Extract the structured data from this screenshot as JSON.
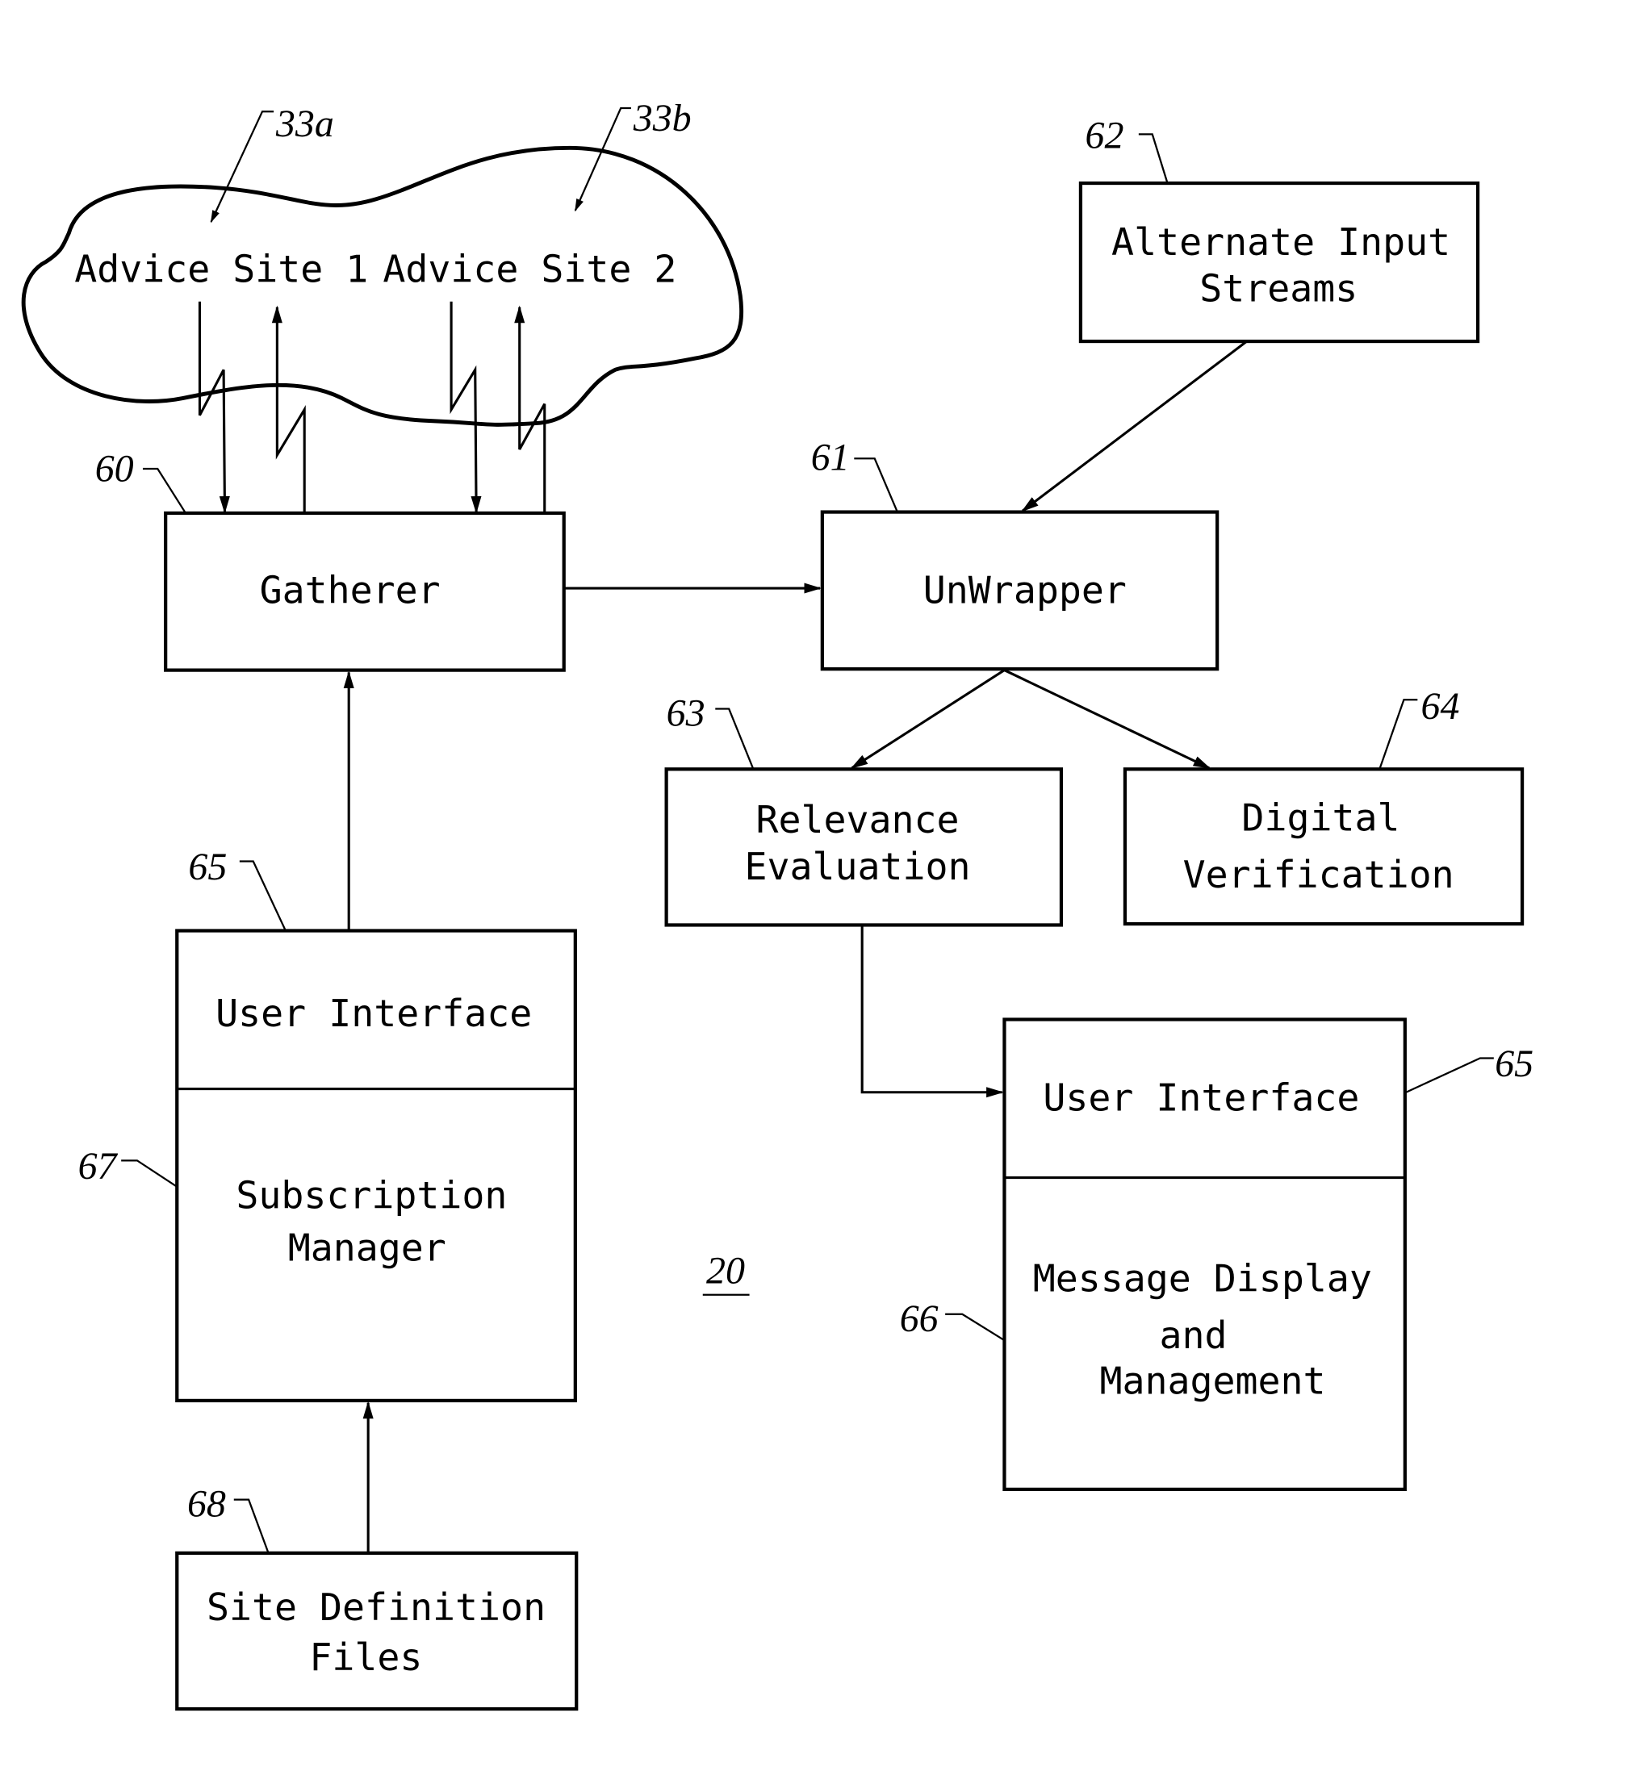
{
  "figure": {
    "number": "20",
    "nodes": {
      "cloud": {
        "ref": [
          "33a",
          "33b"
        ],
        "sites": [
          "Advice Site 1",
          "Advice Site 2"
        ]
      },
      "gatherer": {
        "ref": "60",
        "lines": [
          "Gatherer"
        ]
      },
      "unwrapper": {
        "ref": "61",
        "lines": [
          "UnWrapper"
        ]
      },
      "alternate_input": {
        "ref": "62",
        "lines": [
          "Alternate Input",
          "Streams"
        ]
      },
      "relevance": {
        "ref": "63",
        "lines": [
          "Relevance",
          "Evaluation"
        ]
      },
      "digital_verification": {
        "ref": "64",
        "lines": [
          "Digital",
          "Verification"
        ]
      },
      "left_ui": {
        "ref": "65",
        "top_lines": [
          "User Interface"
        ],
        "bottom_ref": "67",
        "bottom_lines": [
          "Subscription",
          "Manager"
        ]
      },
      "right_ui": {
        "ref": "65",
        "top_lines": [
          "User Interface"
        ],
        "bottom_ref": "66",
        "bottom_lines": [
          "Message Display",
          "and",
          "Management"
        ]
      },
      "site_definition": {
        "ref": "68",
        "lines": [
          "Site Definition",
          "Files"
        ]
      }
    },
    "edges": [
      {
        "from": "advice-site-1",
        "to": "gatherer",
        "type": "wireless"
      },
      {
        "from": "gatherer",
        "to": "advice-site-1",
        "type": "wireless"
      },
      {
        "from": "advice-site-2",
        "to": "gatherer",
        "type": "wireless"
      },
      {
        "from": "gatherer",
        "to": "advice-site-2",
        "type": "wireless"
      },
      {
        "from": "gatherer",
        "to": "unwrapper"
      },
      {
        "from": "alternate_input",
        "to": "unwrapper"
      },
      {
        "from": "unwrapper",
        "to": "relevance"
      },
      {
        "from": "unwrapper",
        "to": "digital_verification"
      },
      {
        "from": "relevance",
        "to": "right_ui"
      },
      {
        "from": "left_ui",
        "to": "gatherer"
      },
      {
        "from": "site_definition",
        "to": "left_ui"
      }
    ]
  }
}
